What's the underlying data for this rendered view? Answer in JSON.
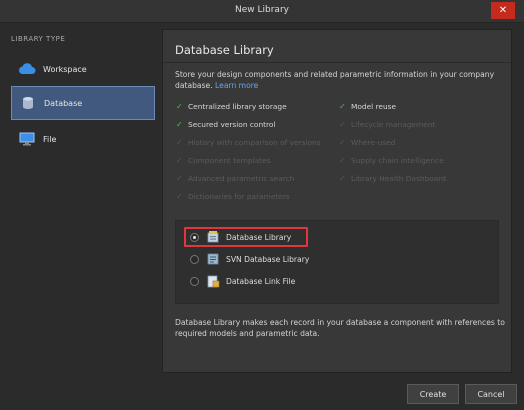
{
  "window": {
    "title": "New Library",
    "close_glyph": "✕"
  },
  "sidebar": {
    "heading": "LIBRARY TYPE",
    "items": [
      {
        "label": "Workspace",
        "icon": "cloud-icon"
      },
      {
        "label": "Database",
        "icon": "database-icon",
        "selected": true
      },
      {
        "label": "File",
        "icon": "monitor-icon"
      }
    ]
  },
  "main": {
    "title": "Database Library",
    "description": "Store your design components and related parametric information in your company database.",
    "learn_more": "Learn more",
    "features_left": [
      {
        "label": "Centralized library storage",
        "enabled": true
      },
      {
        "label": "Secured version control",
        "enabled": true
      },
      {
        "label": "History with comparison of versions",
        "enabled": false
      },
      {
        "label": "Component templates",
        "enabled": false
      },
      {
        "label": "Advanced parametric search",
        "enabled": false
      },
      {
        "label": "Dictionaries for parameters",
        "enabled": false
      }
    ],
    "features_right": [
      {
        "label": "Model reuse",
        "enabled": true
      },
      {
        "label": "Lifecycle management",
        "enabled": false
      },
      {
        "label": "Where-used",
        "enabled": false
      },
      {
        "label": "Supply chain intelligence",
        "enabled": false
      },
      {
        "label": "Library Health Dashboard",
        "enabled": false
      }
    ],
    "check_glyph": "✓",
    "options": [
      {
        "label": "Database Library",
        "checked": true
      },
      {
        "label": "SVN Database Library",
        "checked": false
      },
      {
        "label": "Database Link File",
        "checked": false
      }
    ],
    "footer_description": "Database Library makes each record in your database a component with references to required models and parametric data."
  },
  "buttons": {
    "create": "Create",
    "cancel": "Cancel"
  },
  "colors": {
    "accent": "#41597e",
    "highlight": "#e0363d",
    "check": "#4fb84f",
    "link": "#6aa6e8"
  }
}
